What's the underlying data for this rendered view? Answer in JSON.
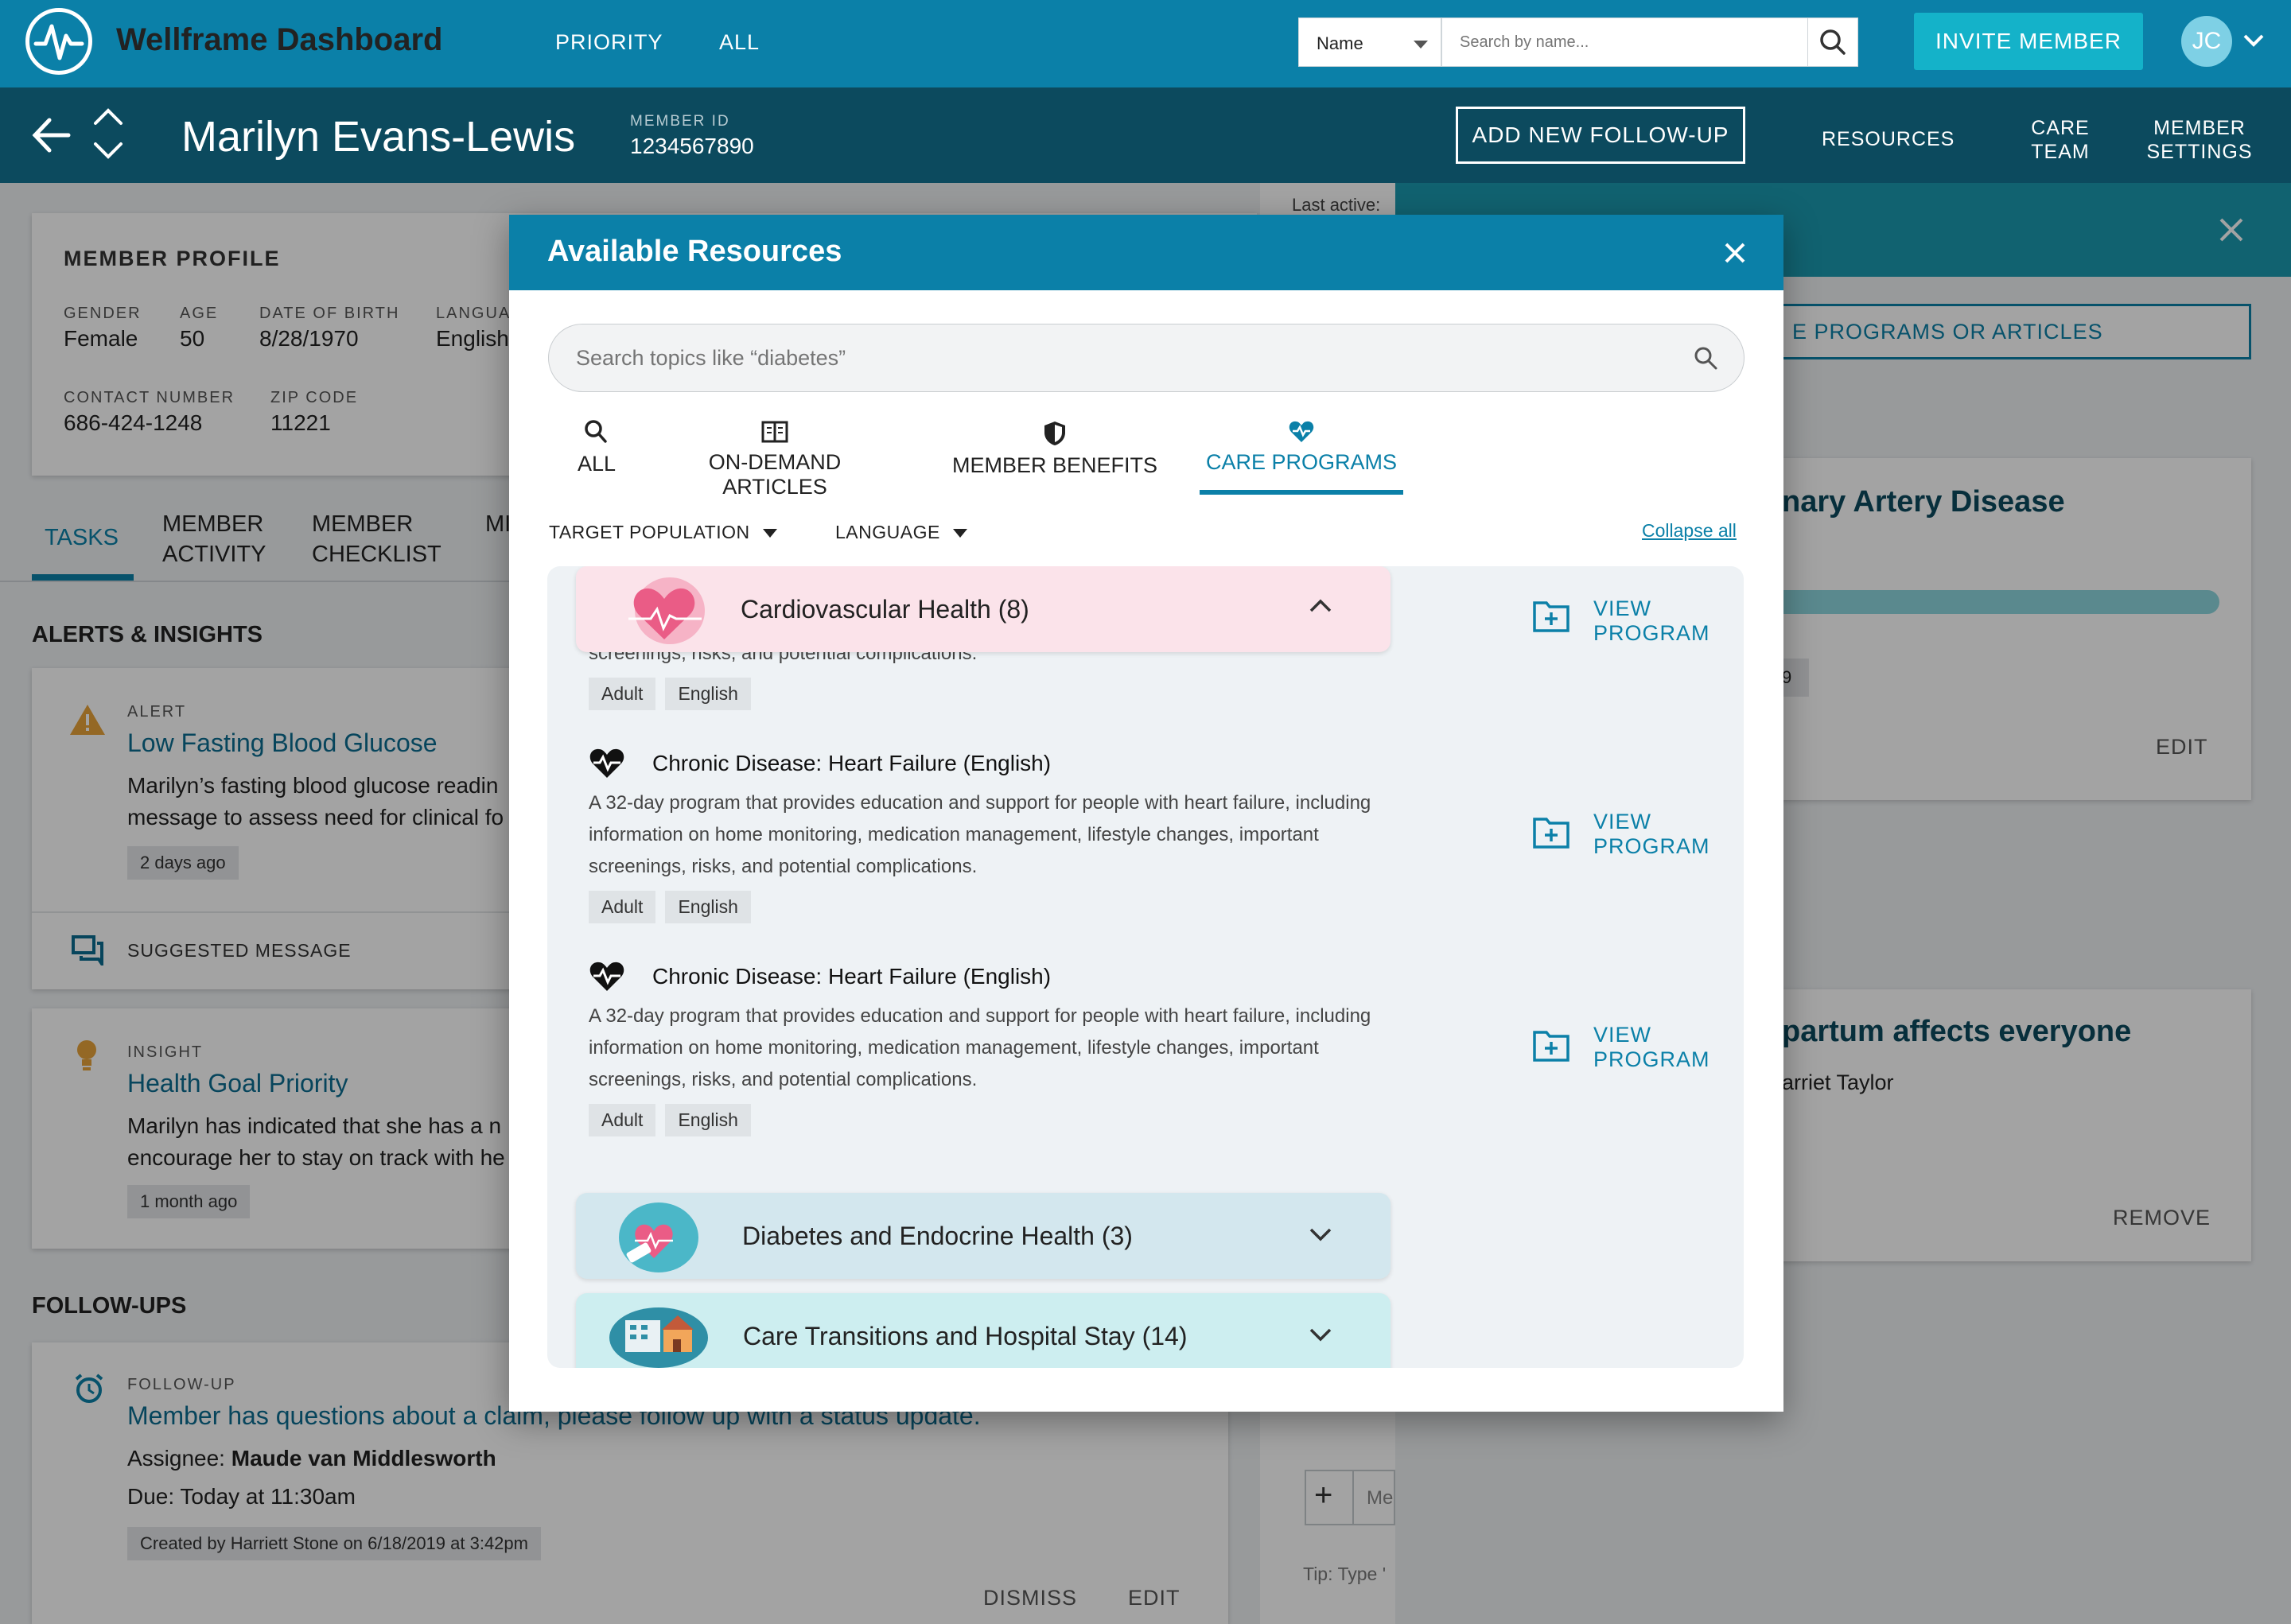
{
  "app": {
    "title": "Wellframe Dashboard",
    "nav": [
      "PRIORITY",
      "ALL"
    ],
    "search": {
      "select_value": "Name",
      "placeholder": "Search by name..."
    },
    "invite_label": "INVITE MEMBER",
    "user_initials": "JC"
  },
  "member": {
    "name": "Marilyn Evans-Lewis",
    "id_label": "MEMBER ID",
    "id": "1234567890",
    "add_followup_label": "ADD NEW FOLLOW-UP",
    "nav": {
      "resources": "RESOURCES",
      "care_team": "CARE\nTEAM",
      "member_settings": "MEMBER\nSETTINGS"
    }
  },
  "profile": {
    "title": "MEMBER PROFILE",
    "gender_label": "GENDER",
    "gender": "Female",
    "age_label": "AGE",
    "age": "50",
    "dob_label": "DATE OF BIRTH",
    "dob": "8/28/1970",
    "language_label": "LANGUA",
    "language": "English",
    "contact_label": "CONTACT NUMBER",
    "contact": "686-424-1248",
    "zip_label": "ZIP CODE",
    "zip": "11221"
  },
  "tabs": {
    "tasks": "TASKS",
    "activity": "MEMBER\nACTIVITY",
    "checklist": "MEMBER\nCHECKLIST",
    "more": "MI"
  },
  "alerts": {
    "section": "ALERTS & INSIGHTS",
    "alert": {
      "kind": "ALERT",
      "title": "Low Fasting Blood Glucose",
      "body1": "Marilyn’s fasting blood glucose readin",
      "body2": "message to assess need for clinical fo",
      "age": "2 days ago",
      "suggested": "SUGGESTED MESSAGE"
    },
    "insight": {
      "kind": "INSIGHT",
      "title": "Health Goal Priority",
      "body1": "Marilyn has indicated that she has a n",
      "body2": "encourage her to stay on track with he",
      "age": "1 month ago"
    }
  },
  "followups": {
    "section": "FOLLOW-UPS",
    "kind": "FOLLOW-UP",
    "title": "Member has questions about a claim, please follow up with a status update.",
    "assignee_label": "Assignee:",
    "assignee": "Maude van Middlesworth",
    "due": "Due: Today at 11:30am",
    "created": "Created by Harriett Stone on 6/18/2019 at 3:42pm",
    "dismiss": "DISMISS",
    "edit": "EDIT"
  },
  "middle": {
    "last_active": "Last active:",
    "compose_placeholder": "Me",
    "tip": "Tip: Type '"
  },
  "right_panel": {
    "search_button": "E PROGRAMS OR ARTICLES",
    "card1_title": "nary Artery Disease",
    "card1_badge": "9",
    "card1_edit": "EDIT",
    "card2_title": "partum affects everyone",
    "card2_author": "arriet Taylor",
    "card2_remove": "REMOVE"
  },
  "modal": {
    "title": "Available Resources",
    "search_placeholder": "Search topics like “diabetes”",
    "tabs": {
      "all": "ALL",
      "articles": "ON-DEMAND ARTICLES",
      "benefits": "MEMBER BENEFITS",
      "programs": "CARE PROGRAMS"
    },
    "filters": {
      "target": "TARGET POPULATION",
      "language": "LANGUAGE"
    },
    "collapse_all": "Collapse all",
    "categories": [
      {
        "title": "Cardiovascular Health (8)",
        "color": "#fbe3ea"
      },
      {
        "title": "Diabetes and Endocrine Health (3)",
        "color": "#d3e7ee"
      },
      {
        "title": "Care Transitions and Hospital Stay (14)",
        "color": "#cdeef0"
      }
    ],
    "truncated_desc": "screenings, risks, and potential complications.",
    "programs": [
      {
        "title": "Chronic Disease: Heart Failure (English)",
        "desc1": "A 32-day program that provides education and support for people with heart failure, including",
        "desc2": "information on home monitoring, medication management, lifestyle changes, important",
        "desc3": "screenings, risks, and potential complications.",
        "tags": [
          "Adult",
          "English"
        ]
      },
      {
        "title": "Chronic Disease: Heart Failure (English)",
        "desc1": "A 32-day program that provides education and support for people with heart failure, including",
        "desc2": "information on home monitoring, medication management, lifestyle changes, important",
        "desc3": "screenings, risks, and potential complications.",
        "tags": [
          "Adult",
          "English"
        ]
      }
    ],
    "truncated_tags": [
      "Adult",
      "English"
    ],
    "view_program": "VIEW\nPROGRAM"
  },
  "colors": {
    "brand": "#0b80a8",
    "header_dark": "#0c4a5e",
    "accent": "#14b2c9",
    "alert": "#e8a33a"
  }
}
